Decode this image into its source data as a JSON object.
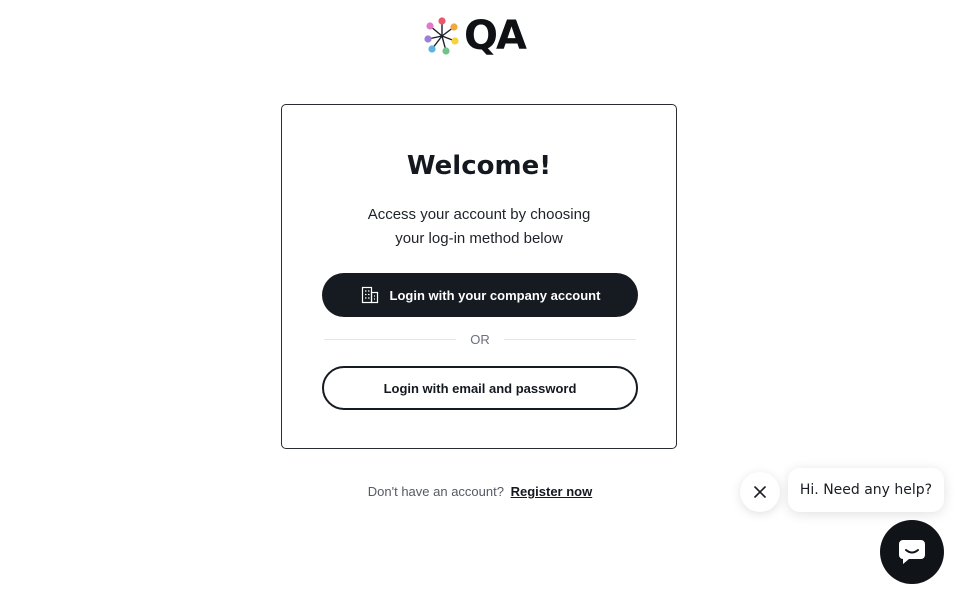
{
  "logo": {
    "text": "QA",
    "icon": "qa-flower-logo-icon",
    "dot_colors": [
      "#e8596b",
      "#f2a93b",
      "#f6d23f",
      "#6fc48a",
      "#5bb3e0",
      "#9a7fd6",
      "#e07ac6"
    ]
  },
  "card": {
    "title": "Welcome!",
    "subtitle_line1": "Access your account by choosing",
    "subtitle_line2": "your log-in method below",
    "company_button": {
      "label": "Login with your company account",
      "icon": "building-icon"
    },
    "divider_text": "OR",
    "email_button": {
      "label": "Login with email and password"
    }
  },
  "register": {
    "prompt": "Don't have an account?",
    "link": "Register now"
  },
  "help_widget": {
    "message": "Hi. Need any help?",
    "close_icon": "close-icon",
    "launcher_icon": "chat-bubble-icon"
  },
  "colors": {
    "primary": "#161b22",
    "background": "#ffffff",
    "muted_text": "#555a63"
  }
}
